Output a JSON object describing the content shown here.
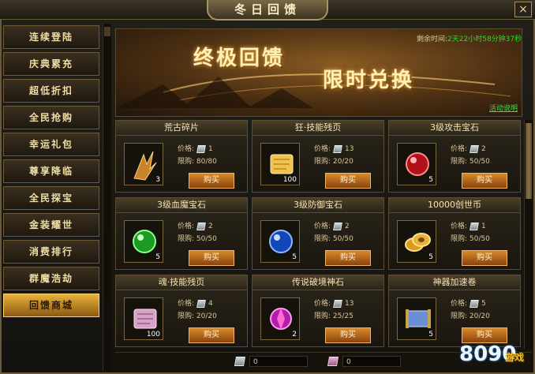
{
  "window": {
    "title": "冬日回馈",
    "close_icon": "×"
  },
  "sidebar": {
    "items": [
      {
        "label": "连续登陆",
        "active": false
      },
      {
        "label": "庆典累充",
        "active": false
      },
      {
        "label": "超低折扣",
        "active": false
      },
      {
        "label": "全民抢购",
        "active": false
      },
      {
        "label": "幸运礼包",
        "active": false
      },
      {
        "label": "尊享降临",
        "active": false
      },
      {
        "label": "全民探宝",
        "active": false
      },
      {
        "label": "金装耀世",
        "active": false
      },
      {
        "label": "消费排行",
        "active": false
      },
      {
        "label": "群魔浩劫",
        "active": false
      },
      {
        "label": "回馈商城",
        "active": true
      }
    ]
  },
  "banner": {
    "line1": "终极回馈",
    "line2": "限时兑换",
    "timer_label": "剩余时间:",
    "timer_value": "2天22小时58分钟37秒",
    "rules_link": "活动说明"
  },
  "shop": {
    "price_label": "价格:",
    "limit_label": "限购:",
    "buy_label": "购买",
    "items": [
      {
        "name": "荒古碎片",
        "price": "1",
        "limit": "80/80",
        "qty": "3",
        "icon": "claw-shard-icon"
      },
      {
        "name": "狂·技能残页",
        "price": "13",
        "limit": "20/20",
        "qty": "100",
        "icon": "golden-scroll-icon"
      },
      {
        "name": "3级攻击宝石",
        "price": "2",
        "limit": "50/50",
        "qty": "5",
        "icon": "red-gem-icon"
      },
      {
        "name": "3级血魔宝石",
        "price": "2",
        "limit": "50/50",
        "qty": "5",
        "icon": "green-gem-icon"
      },
      {
        "name": "3级防御宝石",
        "price": "2",
        "limit": "50/50",
        "qty": "5",
        "icon": "blue-gem-icon"
      },
      {
        "name": "10000创世币",
        "price": "1",
        "limit": "50/50",
        "qty": "5",
        "icon": "gold-coins-icon"
      },
      {
        "name": "魂·技能残页",
        "price": "4",
        "limit": "20/20",
        "qty": "100",
        "icon": "pink-scroll-icon"
      },
      {
        "name": "传说破境神石",
        "price": "13",
        "limit": "25/25",
        "qty": "2",
        "icon": "purple-stone-icon"
      },
      {
        "name": "神器加速卷",
        "price": "5",
        "limit": "20/20",
        "qty": "5",
        "icon": "blue-scroll-icon"
      }
    ]
  },
  "footer": {
    "silver_balance": "0",
    "pink_balance": "0"
  },
  "watermark": {
    "text": "8090",
    "sub": "游戏"
  },
  "colors": {
    "accent": "#e8b23a",
    "timer": "#22e022",
    "link": "#3de33d"
  }
}
